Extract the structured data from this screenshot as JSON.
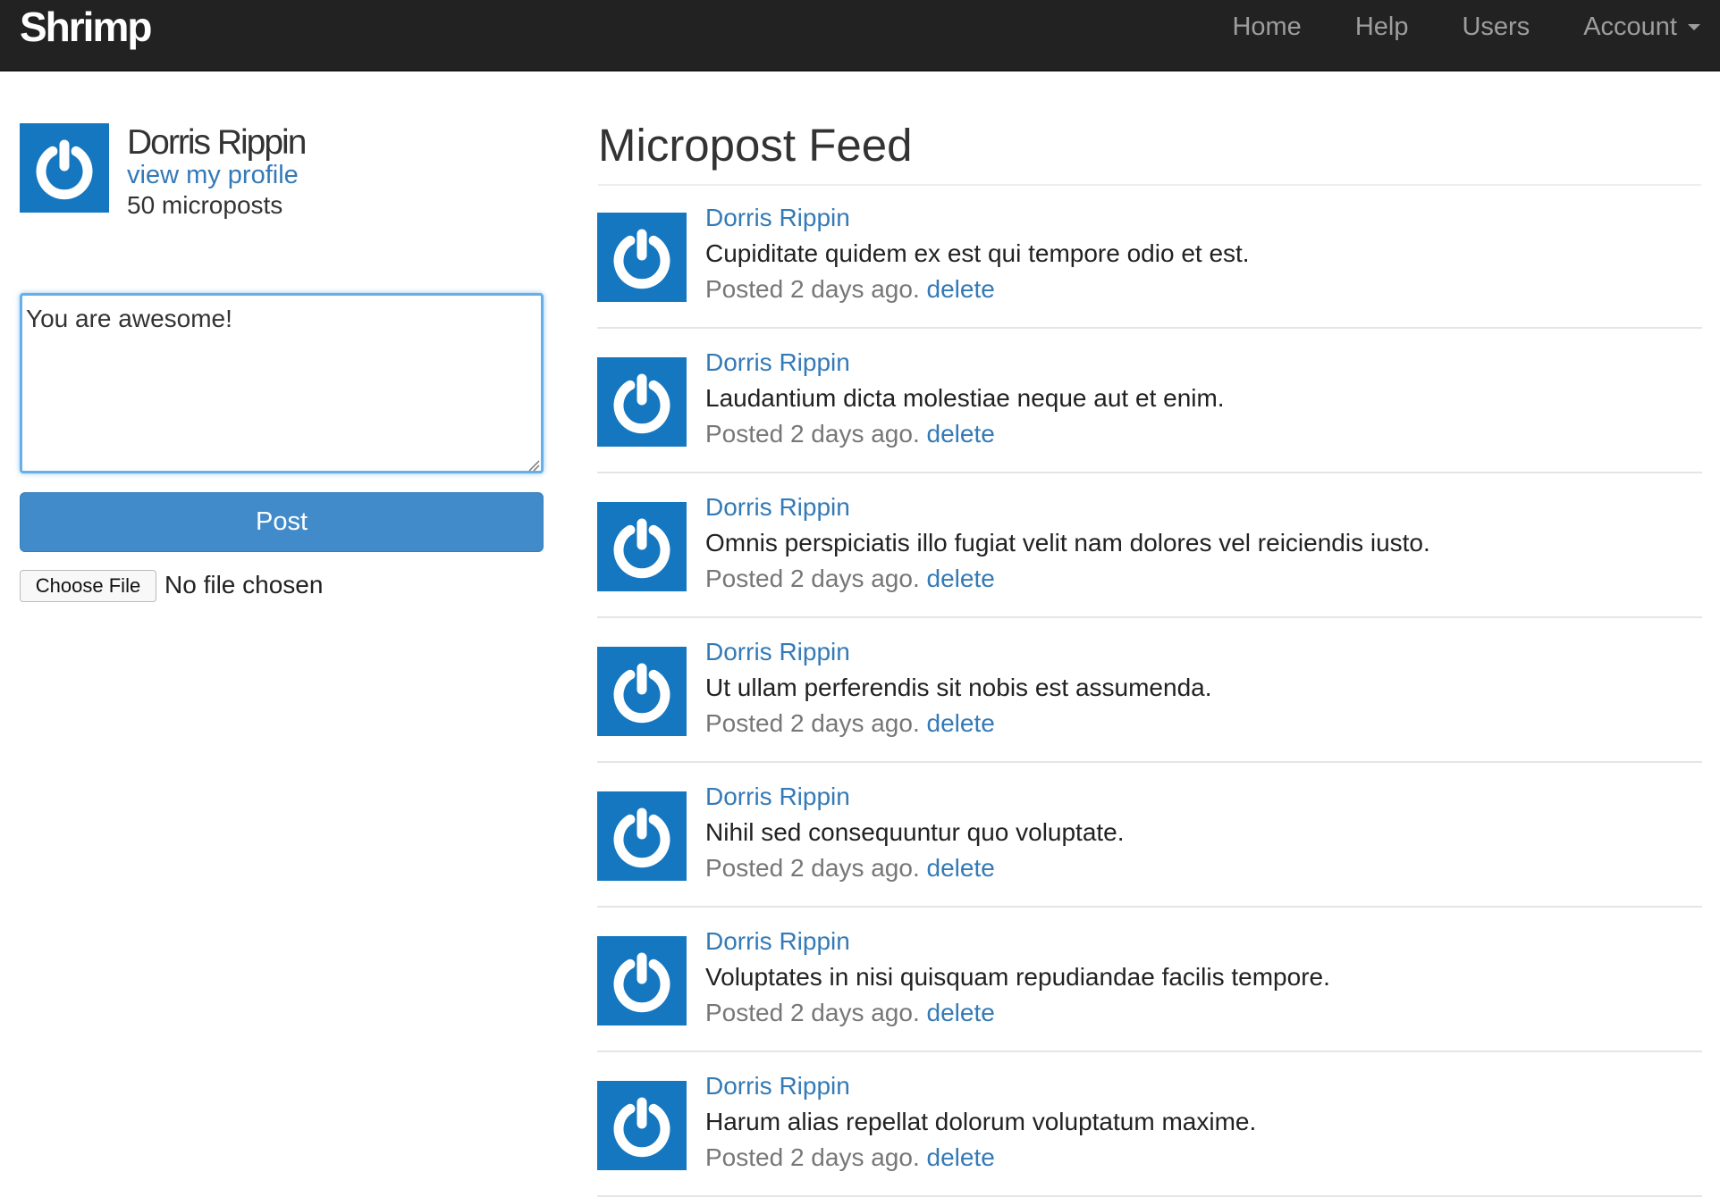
{
  "navbar": {
    "brand": "Shrimp",
    "links": {
      "home": "Home",
      "help": "Help",
      "users": "Users",
      "account": "Account"
    }
  },
  "sidebar": {
    "user_name": "Dorris Rippin",
    "profile_link": "view my profile",
    "micropost_count": "50 microposts",
    "composer": {
      "value": "You are awesome!",
      "post_label": "Post",
      "file_button": "Choose File",
      "file_status": "No file chosen"
    }
  },
  "feed": {
    "title": "Micropost Feed",
    "items": [
      {
        "user": "Dorris Rippin",
        "content": "Cupiditate quidem ex est qui tempore odio et est.",
        "posted": "Posted 2 days ago.",
        "delete": "delete"
      },
      {
        "user": "Dorris Rippin",
        "content": "Laudantium dicta molestiae neque aut et enim.",
        "posted": "Posted 2 days ago.",
        "delete": "delete"
      },
      {
        "user": "Dorris Rippin",
        "content": "Omnis perspiciatis illo fugiat velit nam dolores vel reiciendis iusto.",
        "posted": "Posted 2 days ago.",
        "delete": "delete"
      },
      {
        "user": "Dorris Rippin",
        "content": "Ut ullam perferendis sit nobis est assumenda.",
        "posted": "Posted 2 days ago.",
        "delete": "delete"
      },
      {
        "user": "Dorris Rippin",
        "content": "Nihil sed consequuntur quo voluptate.",
        "posted": "Posted 2 days ago.",
        "delete": "delete"
      },
      {
        "user": "Dorris Rippin",
        "content": "Voluptates in nisi quisquam repudiandae facilis tempore.",
        "posted": "Posted 2 days ago.",
        "delete": "delete"
      },
      {
        "user": "Dorris Rippin",
        "content": "Harum alias repellat dolorum voluptatum maxime.",
        "posted": "Posted 2 days ago.",
        "delete": "delete"
      }
    ]
  },
  "colors": {
    "navbar_bg": "#222222",
    "link": "#337ab7",
    "button": "#428bca",
    "gravatar_bg": "#1577c0",
    "focus_ring": "#66afe9"
  },
  "icons": {
    "avatar": "power-icon",
    "account_menu": "caret-down-icon",
    "textarea_resize": "resize-grip-icon"
  }
}
